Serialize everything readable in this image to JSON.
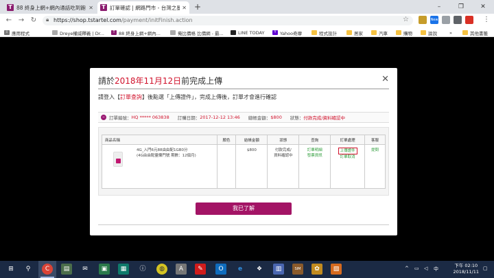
{
  "browser": {
    "tabs": [
      {
        "icon": "T",
        "title": "88 終身上網+網內通話吃到飽 -"
      },
      {
        "icon": "T",
        "title": "訂單確認 | 網路門市 - 台灣之星"
      }
    ],
    "new_tab": "+",
    "window_controls": {
      "minimize": "–",
      "maximize": "❐",
      "close": "✕"
    },
    "url_host": "https://shop.tstartel.com",
    "url_path": "/payment/initFinish.action",
    "extensions": [
      {
        "label": "",
        "color": "#c69c2a"
      },
      {
        "label": "New",
        "color": "#1a73e8"
      },
      {
        "label": "",
        "color": "#9aa0a6"
      },
      {
        "label": "",
        "color": "#5f6368"
      },
      {
        "label": "",
        "color": "#d93025"
      },
      {
        "label": "",
        "color": "#b31412"
      }
    ]
  },
  "bookmarks": {
    "items": [
      {
        "label": "應用程式",
        "icon": "apps"
      },
      {
        "label": "Dreye權威釋義 | Dr...",
        "icon": "page"
      },
      {
        "label": "88 終身上網+網內...",
        "icon": "T"
      },
      {
        "label": "俺比價格 比價網 - 最...",
        "icon": "page"
      },
      {
        "label": "LINE TODAY",
        "icon": "LINE"
      },
      {
        "label": "Yahoo奇摩",
        "icon": "Y!"
      },
      {
        "label": "程式設計",
        "icon": "folder"
      },
      {
        "label": "居家",
        "icon": "folder"
      },
      {
        "label": "汽車",
        "icon": "folder"
      },
      {
        "label": "購物",
        "icon": "folder"
      },
      {
        "label": "論說",
        "icon": "folder"
      }
    ],
    "more": "»",
    "other": "其他書籤"
  },
  "modal": {
    "title_prefix": "請於",
    "deadline": "2018年11月12日",
    "title_suffix": "前完成上傳",
    "close": "✕",
    "instruction_prefix": "請登入【",
    "instruction_link": "訂單查詢",
    "instruction_suffix": "】後點選「上傳證件」，完成上傳後，訂單才會進行確認",
    "order_no_label": "訂單編號：",
    "order_no": "HQ ***** 063838",
    "order_date_label": "訂購日期：",
    "order_date": "2017-12-12 13:46",
    "amount_label": "總帳金額：",
    "amount": "$800",
    "status_label": "狀態：",
    "status": "付款完成/資料確認中",
    "table": {
      "headers": [
        "商品名稱",
        "顏色",
        "結帳金額",
        "狀態",
        "查詢",
        "訂單處理",
        "客服"
      ],
      "row": {
        "product_line1": "4G_入門6元88由由配1GB0分",
        "product_line2": "(4G由由配量懶門號 期數：12個月)",
        "color": "",
        "price": "$800",
        "status_line1": "付款完成/",
        "status_line2": "資料確認中",
        "query_line1": "訂單明細",
        "query_line2": "發票資訊",
        "action_upload": "上傳證件",
        "action_cancel": "訂單取消",
        "service": "提問"
      }
    },
    "confirm_button": "我已了解"
  },
  "taskbar": {
    "icons": [
      "⊞",
      "⚲",
      "C",
      "▤",
      "✉",
      "▣",
      "▦",
      "ⓘ",
      "◍",
      "A",
      "✎",
      "O",
      "e",
      "❖",
      "▥",
      "SIM",
      "✿",
      "▧"
    ],
    "time": "下午 02:10",
    "date": "2018/11/11"
  }
}
